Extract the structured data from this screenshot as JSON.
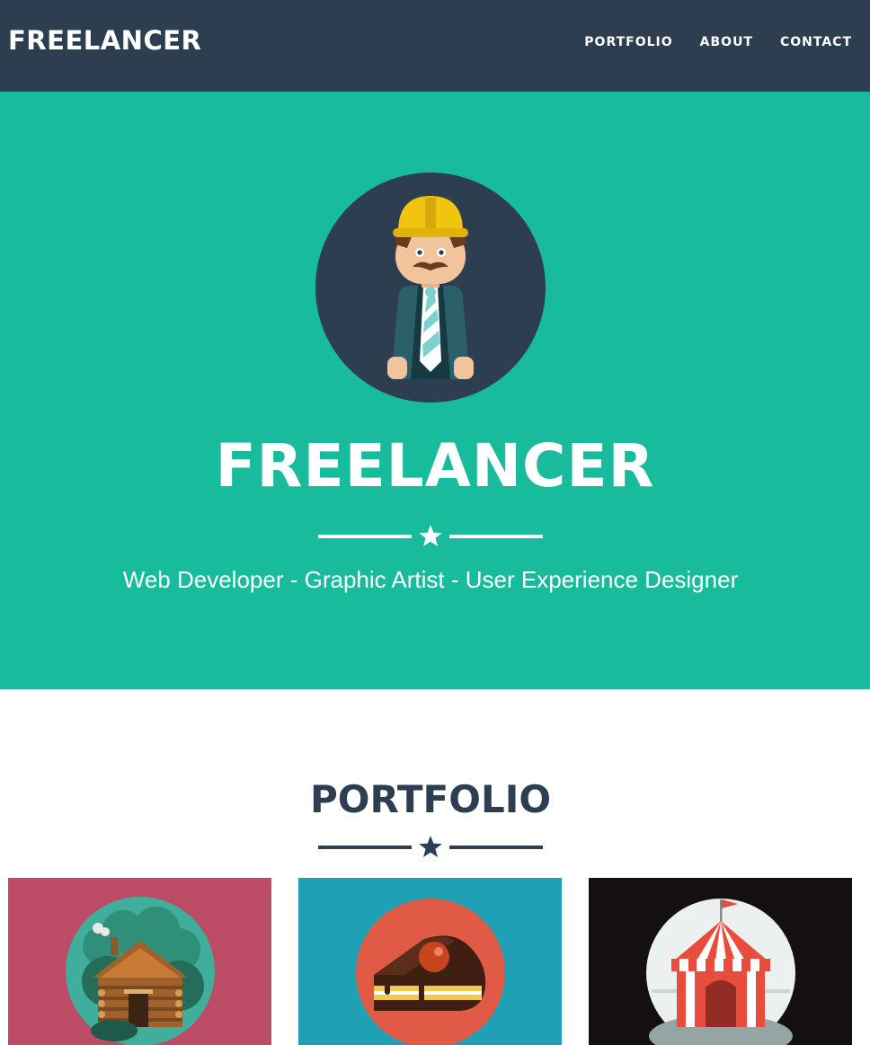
{
  "navbar": {
    "brand": "FREELANCER",
    "links": [
      "PORTFOLIO",
      "ABOUT",
      "CONTACT"
    ]
  },
  "hero": {
    "avatar_icon": "freelancer-avatar-icon",
    "title": "FREELANCER",
    "subtitle": "Web Developer - Graphic Artist - User Experience Designer"
  },
  "portfolio": {
    "title": "PORTFOLIO",
    "items": [
      {
        "icon": "cabin-icon",
        "background": "#bc4b65"
      },
      {
        "icon": "cake-icon",
        "background": "#20a0b5"
      },
      {
        "icon": "circus-tent-icon",
        "background": "#151010"
      }
    ]
  },
  "colors": {
    "navbar": "#2c3e50",
    "primary": "#18bc9c",
    "heading": "#2c3e50"
  }
}
